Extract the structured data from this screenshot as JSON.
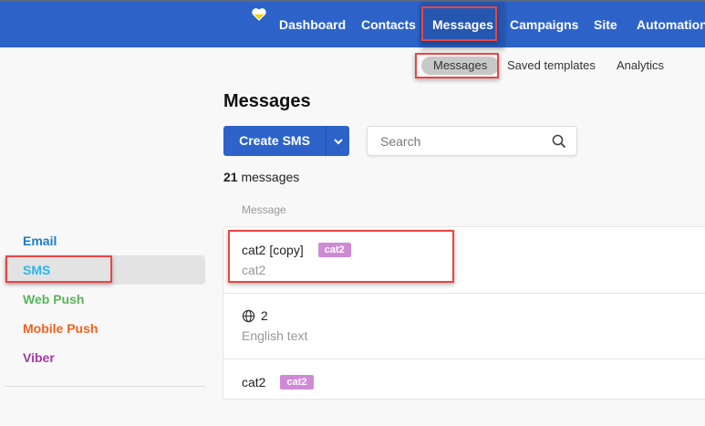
{
  "topnav": {
    "items": [
      "Dashboard",
      "Contacts",
      "Messages",
      "Campaigns",
      "Site",
      "Automation"
    ],
    "active": "Messages"
  },
  "subnav": {
    "items": [
      "Messages",
      "Saved templates",
      "Analytics"
    ],
    "active": "Messages"
  },
  "page_title": "Messages",
  "create_button": "Create SMS",
  "search": {
    "placeholder": "Search",
    "value": ""
  },
  "count": {
    "number": "21",
    "label": "messages"
  },
  "column_header": "Message",
  "messages": [
    {
      "title": "cat2 [copy]",
      "tag": "cat2",
      "subtitle": "cat2"
    },
    {
      "title": "2",
      "subtitle": "English text",
      "icon": "globe-icon"
    },
    {
      "title": "cat2",
      "tag": "cat2"
    }
  ],
  "sidebar": {
    "items": [
      {
        "label": "Email",
        "color": "#1a7fc9"
      },
      {
        "label": "SMS",
        "color": "#29b6f0"
      },
      {
        "label": "Web Push",
        "color": "#5cb35c"
      },
      {
        "label": "Mobile Push",
        "color": "#f0621e"
      },
      {
        "label": "Viber",
        "color": "#a23aab"
      }
    ],
    "active": "SMS"
  },
  "colors": {
    "brand": "#2d63c8",
    "tag": "#cf8ad6",
    "highlight": "#e94545"
  }
}
